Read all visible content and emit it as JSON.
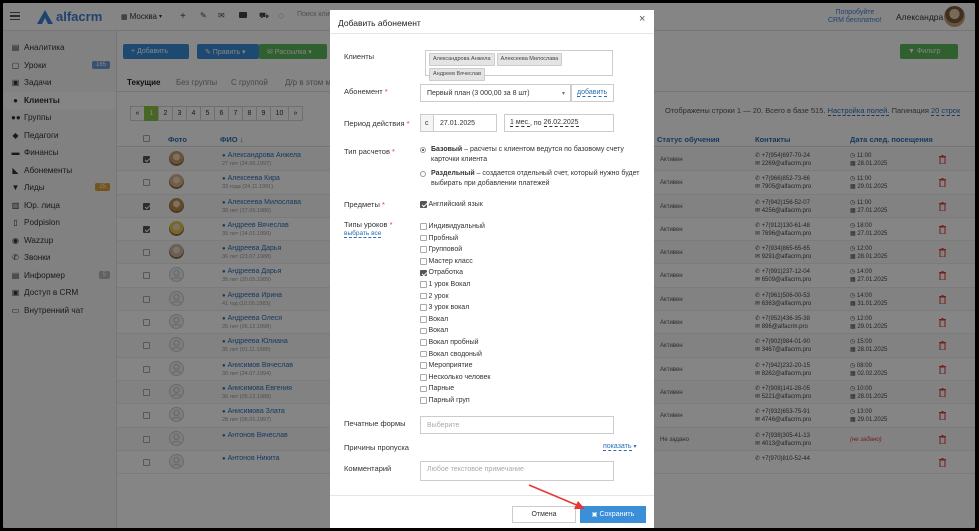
{
  "topbar": {
    "brand": "alfacrm",
    "branch": "Москва",
    "search_placeholder": "Поиск клие",
    "promo_line1": "Попробуйте",
    "promo_line2": "CRM бесплатно!",
    "user_name": "Александра"
  },
  "sidebar": {
    "items": [
      {
        "label": "Аналитика",
        "icon": "chart-icon",
        "badge": ""
      },
      {
        "label": "Уроки",
        "icon": "calendar-icon",
        "badge": "165"
      },
      {
        "label": "Задачи",
        "icon": "tasks-icon",
        "badge": ""
      },
      {
        "label": "Клиенты",
        "icon": "user-icon",
        "badge": ""
      },
      {
        "label": "Группы",
        "icon": "group-icon",
        "badge": ""
      },
      {
        "label": "Педагоги",
        "icon": "teacher-icon",
        "badge": ""
      },
      {
        "label": "Финансы",
        "icon": "money-icon",
        "badge": ""
      },
      {
        "label": "Абонементы",
        "icon": "tag-icon",
        "badge": ""
      },
      {
        "label": "Лиды",
        "icon": "funnel-icon",
        "badge": "25"
      },
      {
        "label": "Юр. лица",
        "icon": "building-icon",
        "badge": ""
      },
      {
        "label": "Podpislon",
        "icon": "doc-icon",
        "badge": ""
      },
      {
        "label": "Wazzup",
        "icon": "chat-icon",
        "badge": ""
      },
      {
        "label": "Звонки",
        "icon": "phone-icon",
        "badge": ""
      },
      {
        "label": "Информер",
        "icon": "bell-icon",
        "badge": "5"
      },
      {
        "label": "Доступ в CRM",
        "icon": "lock-icon",
        "badge": ""
      },
      {
        "label": "Внутренний чат",
        "icon": "message-icon",
        "badge": ""
      }
    ]
  },
  "toolbar": {
    "add_label": "+ Добавить",
    "edit_label": "✎ Править ▾",
    "mailing_label": "✉ Рассылка ▾",
    "filter_label": "▼ Фильтр"
  },
  "tabs": [
    "Текущие",
    "Без группы",
    "С группой",
    "Д/р в этом ме"
  ],
  "pagination": [
    "«",
    "1",
    "2",
    "3",
    "4",
    "5",
    "6",
    "7",
    "8",
    "9",
    "10",
    "»"
  ],
  "summary": {
    "text": "Отображены строки 1 — 20. Всего в базе 515.",
    "settings_link": "Настройка полей.",
    "pagination_label": "Пагинация",
    "pagination_value": "20 строк"
  },
  "table": {
    "headers": {
      "photo": "Фото",
      "name": "ФИО ↓",
      "status": "Статус обучения",
      "contacts": "Контакты",
      "next_visit": "Дата след. посещения"
    },
    "rows": [
      {
        "checked": true,
        "name": "Александрова Анжела",
        "sub": "27 лет (24.06.1997)",
        "status": "Активен",
        "phone": "+7(954)697-70-24",
        "email": "2269@alfacrm.pro",
        "time": "11:00",
        "date": "28.01.2025",
        "avatar": "#c9a06a"
      },
      {
        "checked": false,
        "name": "Алексеева Кира",
        "sub": "33 года (24.11.1991)",
        "status": "Активен",
        "phone": "+7(966)852-73-66",
        "email": "7905@alfacrm.pro",
        "time": "11:00",
        "date": "29.01.2025",
        "avatar": "#d8b48a"
      },
      {
        "checked": true,
        "name": "Алексеева Милослава",
        "sub": "38 лет (17.06.1986)",
        "status": "Активен",
        "phone": "+7(942)156-52-07",
        "email": "4256@alfacrm.pro",
        "time": "11:00",
        "date": "27.01.2025",
        "avatar": "#b6914e"
      },
      {
        "checked": true,
        "name": "Андреев Вячеслав",
        "sub": "35 лет (14.01.1990)",
        "status": "Активен",
        "phone": "+7(912)130-61-48",
        "email": "7696@alfacrm.pro",
        "time": "18:00",
        "date": "27.01.2025",
        "avatar": "#e3c84a"
      },
      {
        "checked": false,
        "name": "Андреева Дарья",
        "sub": "36 лет (23.07.1988)",
        "status": "Активен",
        "phone": "+7(934)865-65-65",
        "email": "9291@alfacrm.pro",
        "time": "12:00",
        "date": "28.01.2025",
        "avatar": "#c8b9a6"
      },
      {
        "checked": false,
        "name": "Андреева Дарья",
        "sub": "35 лет (20.05.1989)",
        "status": "Активен",
        "phone": "+7(991)237-12-04",
        "email": "6509@alfacrm.pro",
        "time": "14:00",
        "date": "27.01.2025",
        "avatar": ""
      },
      {
        "checked": false,
        "name": "Андреева Ирина",
        "sub": "41 год (10.05.1983)",
        "status": "Активен",
        "phone": "+7(961)506-00-53",
        "email": "6363@alfacrm.pro",
        "time": "14:00",
        "date": "31.01.2025",
        "avatar": ""
      },
      {
        "checked": false,
        "name": "Андреева Олеся",
        "sub": "26 лет (06.12.1998)",
        "status": "Активен",
        "phone": "+7(952)436-35-38",
        "email": "896@alfacrm.pro",
        "time": "12:00",
        "date": "29.01.2025",
        "avatar": ""
      },
      {
        "checked": false,
        "name": "Андреева Юлиана",
        "sub": "35 лет (01.11.1989)",
        "status": "Активен",
        "phone": "+7(902)984-01-90",
        "email": "3467@alfacrm.pro",
        "time": "15:00",
        "date": "28.01.2025",
        "avatar": ""
      },
      {
        "checked": false,
        "name": "Анисимов Вячеслав",
        "sub": "30 лет (24.07.1994)",
        "status": "Активен",
        "phone": "+7(942)232-20-15",
        "email": "8262@alfacrm.pro",
        "time": "08:00",
        "date": "02.02.2025",
        "avatar": ""
      },
      {
        "checked": false,
        "name": "Анисимова Евгения",
        "sub": "36 лет (05.12.1988)",
        "status": "Активен",
        "phone": "+7(908)141-28-05",
        "email": "5221@alfacrm.pro",
        "time": "10:00",
        "date": "28.01.2025",
        "avatar": ""
      },
      {
        "checked": false,
        "name": "Анисимова Злата",
        "sub": "28 лет (05.01.1997)",
        "status": "Активен",
        "phone": "+7(932)653-75-91",
        "email": "4746@alfacrm.pro",
        "time": "13:00",
        "date": "29.01.2025",
        "avatar": ""
      },
      {
        "checked": false,
        "name": "Антонов Вячеслав",
        "sub": "",
        "status": "Не задано",
        "phone": "+7(938)305-41-13",
        "email": "4013@alfacrm.pro",
        "time": "",
        "date": "(не задано)",
        "avatar": ""
      },
      {
        "checked": false,
        "name": "Антонов Никита",
        "sub": "",
        "status": "",
        "phone": "+7(970)810-52-44",
        "email": "",
        "time": "",
        "date": "",
        "avatar": ""
      }
    ]
  },
  "modal": {
    "title": "Добавить абонемент",
    "close": "×",
    "clients_label": "Клиенты",
    "clients": [
      "Александрова Анжела",
      "Алексеева Милослава",
      "Андреев Вячеслав"
    ],
    "subscription_label": "Абонемент",
    "subscription_value": "Первый план (3 000,00 за 8 шт)",
    "subscription_add": "добавить",
    "period_label": "Период действия",
    "period_from_prefix": "с",
    "period_from": "27.01.2025",
    "period_duration": "1 мес.",
    "period_to_prefix": "по",
    "period_to": "26.02.2025",
    "calc_label": "Тип расчетов",
    "calc_base_title": "Базовый",
    "calc_base_text": "– расчеты с клиентом ведутся по базовому счету карточки клиента",
    "calc_sep_title": "Раздельный",
    "calc_sep_text": "– создается отдельный счет, который нужно будет выбирать при добавлении платежей",
    "subjects_label": "Предметы",
    "subject": "Английский язык",
    "lesson_types_label": "Типы уроков",
    "select_all": "выбрать все",
    "lesson_types": [
      {
        "label": "Индивидуальный",
        "checked": false
      },
      {
        "label": "Пробный",
        "checked": false
      },
      {
        "label": "Групповой",
        "checked": false
      },
      {
        "label": "Мастер класс",
        "checked": false
      },
      {
        "label": "Отработка",
        "checked": true
      },
      {
        "label": "1 урок Вокал",
        "checked": false
      },
      {
        "label": "2 урок",
        "checked": false
      },
      {
        "label": "3 урок вокал",
        "checked": false
      },
      {
        "label": "Вокал",
        "checked": false
      },
      {
        "label": "Вокал",
        "checked": false
      },
      {
        "label": "Вокал пробный",
        "checked": false
      },
      {
        "label": "Вокал сводоный",
        "checked": false
      },
      {
        "label": "Мероприятие",
        "checked": false
      },
      {
        "label": "Несколько человек",
        "checked": false
      },
      {
        "label": "Парные",
        "checked": false
      },
      {
        "label": "Парный груп",
        "checked": false
      }
    ],
    "print_forms_label": "Печатные формы",
    "print_forms_placeholder": "Выберите",
    "absence_label": "Причины пропуска",
    "absence_show": "показать",
    "comment_label": "Комментарий",
    "comment_placeholder": "Любое текстовое примечание",
    "cancel_label": "Отмена",
    "save_label": "Сохранить"
  },
  "colors": {
    "brand_blue": "#3f7fd3",
    "button_blue": "#3a8fd8",
    "button_green": "#5cb85c",
    "page_active_green": "#8bc34a",
    "delete_red": "#e53935",
    "annotation_red": "#e53935"
  }
}
